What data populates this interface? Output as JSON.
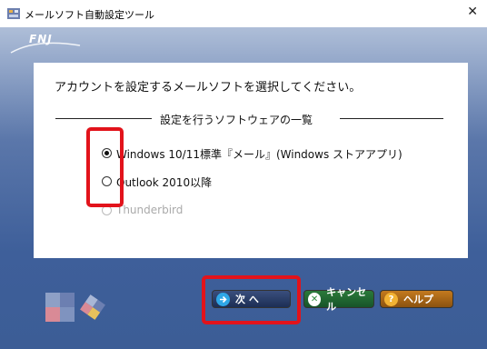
{
  "window": {
    "title": "メールソフト自動設定ツール",
    "close_glyph": "✕"
  },
  "logo": {
    "text": "FNJ"
  },
  "content": {
    "heading": "アカウントを設定するメールソフトを選択してください。",
    "section_title": "設定を行うソフトウェアの一覧",
    "options": [
      {
        "label": "Windows 10/11標準『メール』(Windows ストアアプリ)",
        "selected": true,
        "enabled": true
      },
      {
        "label": "Outlook 2010以降",
        "selected": false,
        "enabled": true
      },
      {
        "label": "Thunderbird",
        "selected": false,
        "enabled": false
      }
    ]
  },
  "buttons": {
    "next_label": "次 へ",
    "cancel_label": "キャンセル",
    "help_label": "ヘルプ",
    "next_icon": "arrow-right-icon",
    "cancel_icon": "close-icon",
    "help_icon": "question-icon"
  },
  "colors": {
    "highlight": "#e2131b",
    "frame": "#3e5f9a"
  }
}
